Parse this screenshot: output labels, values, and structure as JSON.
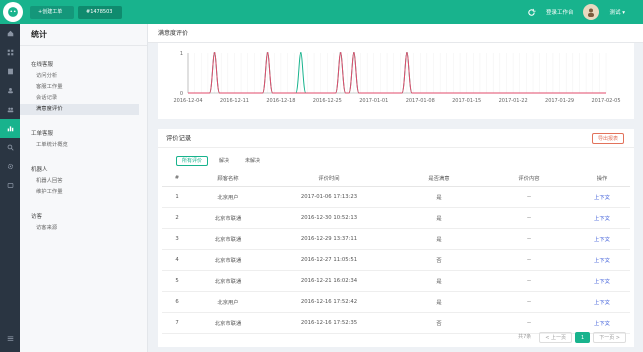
{
  "topbar": {
    "tabs": [
      "+创建工单",
      "#1478503"
    ],
    "workspace_label": "登录工作台",
    "user_label": "测试 ▾"
  },
  "sidebar": {
    "title": "统计",
    "groups": [
      {
        "label": "在线客服",
        "items": [
          "访问分析",
          "客服工作量",
          "会话记录",
          "满意度评价"
        ]
      },
      {
        "label": "工单客服",
        "items": [
          "工单统计概览"
        ]
      },
      {
        "label": "机器人",
        "items": [
          "机器人回答",
          "维护工作量"
        ]
      },
      {
        "label": "访客",
        "items": [
          "访客来源"
        ]
      }
    ]
  },
  "breadcrumb": "满意度评价",
  "chart_data": {
    "type": "line",
    "x": [
      "2016-12-04",
      "2016-12-11",
      "2016-12-18",
      "2016-12-25",
      "2017-01-01",
      "2017-01-08",
      "2017-01-15",
      "2017-01-22",
      "2017-01-29",
      "2017-02-05"
    ],
    "yticks": [
      "1",
      "0"
    ],
    "ylim": [
      0,
      1
    ],
    "series": [
      {
        "color": "#18b38d",
        "peaks": [
          "2016-12-08",
          "2016-12-16",
          "2016-12-21",
          "2016-12-27",
          "2016-12-29",
          "2017-01-06"
        ]
      },
      {
        "color": "#e24b6b",
        "peaks": [
          "2016-12-08",
          "2016-12-16",
          "2016-12-27",
          "2016-12-29",
          "2017-01-06"
        ]
      }
    ]
  },
  "records": {
    "title": "评价记录",
    "export_label": "导出报表",
    "filters": [
      "所有评价",
      "解决",
      "未解决"
    ],
    "headers": [
      "#",
      "顾客名称",
      "评价时间",
      "是否满意",
      "评价内容",
      "操作"
    ],
    "rows": [
      [
        "1",
        "北京用户",
        "2017-01-06 17:13:23",
        "是",
        "--",
        "上下文"
      ],
      [
        "2",
        "北京市联通",
        "2016-12-30 10:52:13",
        "是",
        "--",
        "上下文"
      ],
      [
        "3",
        "北京市联通",
        "2016-12-29 13:37:11",
        "是",
        "--",
        "上下文"
      ],
      [
        "4",
        "北京市联通",
        "2016-12-27 11:05:51",
        "否",
        "--",
        "上下文"
      ],
      [
        "5",
        "北京市联通",
        "2016-12-21 16:02:34",
        "是",
        "--",
        "上下文"
      ],
      [
        "6",
        "北京用户",
        "2016-12-16 17:52:42",
        "是",
        "--",
        "上下文"
      ],
      [
        "7",
        "北京市联通",
        "2016-12-16 17:52:35",
        "否",
        "--",
        "上下文"
      ]
    ],
    "pager": {
      "total": "共7条",
      "prev": "< 上一页",
      "current": "1",
      "next": "下一页 >"
    }
  }
}
